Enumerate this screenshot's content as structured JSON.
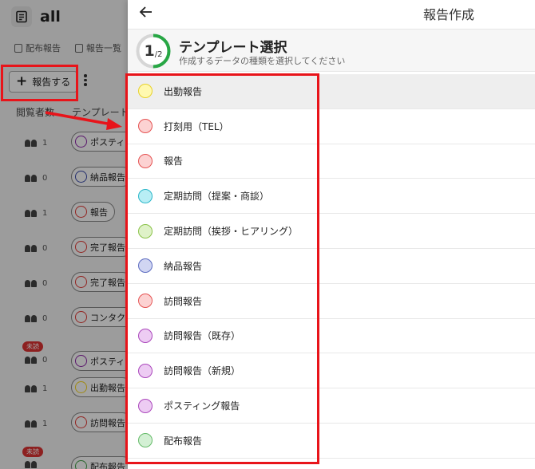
{
  "background": {
    "app_title": "all",
    "tabs": [
      {
        "label": "配布報告"
      },
      {
        "label": "報告一覧"
      }
    ],
    "add_button_label": "報告する",
    "columns": [
      "閲覧者数",
      "テンプレート"
    ],
    "rows": [
      {
        "viewers": "1",
        "unread": "",
        "template": "ポスティング報告",
        "color": "#8e24aa"
      },
      {
        "viewers": "0",
        "unread": "",
        "template": "納品報告",
        "color": "#3949ab"
      },
      {
        "viewers": "1",
        "unread": "",
        "template": "報告",
        "color": "#e53935"
      },
      {
        "viewers": "0",
        "unread": "",
        "template": "完了報告",
        "color": "#e53935"
      },
      {
        "viewers": "0",
        "unread": "",
        "template": "完了報告",
        "color": "#e53935"
      },
      {
        "viewers": "0",
        "unread": "",
        "template": "コンタクト",
        "color": "#e53935"
      },
      {
        "viewers": "0",
        "unread": "未読",
        "template": "ポスティング",
        "color": "#8e24aa"
      },
      {
        "viewers": "1",
        "unread": "",
        "template": "出勤報告",
        "color": "#f9d71c"
      },
      {
        "viewers": "1",
        "unread": "",
        "template": "訪問報告",
        "color": "#e53935"
      },
      {
        "viewers": "",
        "unread": "未読",
        "template": "配布報告",
        "color": "#43a047"
      }
    ]
  },
  "panel": {
    "title": "報告作成",
    "step": {
      "current": "1",
      "total": "/2",
      "progress_fraction": 0.5
    },
    "step_title": "テンプレート選択",
    "step_subtitle": "作成するデータの種類を選択してください",
    "templates": [
      {
        "label": "出勤報告",
        "border": "#e8d22c",
        "fill": "#fff9b0"
      },
      {
        "label": "打刻用（TEL）",
        "border": "#e55353",
        "fill": "#fcd2d2"
      },
      {
        "label": "報告",
        "border": "#e55353",
        "fill": "#fcd2d2"
      },
      {
        "label": "定期訪問（提案・商談）",
        "border": "#2bb7c9",
        "fill": "#b8eef5"
      },
      {
        "label": "定期訪問（挨拶・ヒアリング）",
        "border": "#8bc34a",
        "fill": "#dff2c8"
      },
      {
        "label": "納品報告",
        "border": "#5c6bc0",
        "fill": "#d0d5f2"
      },
      {
        "label": "訪問報告",
        "border": "#e55353",
        "fill": "#fcd2d2"
      },
      {
        "label": "訪問報告（既存）",
        "border": "#ab47bc",
        "fill": "#edccf3"
      },
      {
        "label": "訪問報告（新規）",
        "border": "#ab47bc",
        "fill": "#edccf3"
      },
      {
        "label": "ポスティング報告",
        "border": "#ab47bc",
        "fill": "#edccf3"
      },
      {
        "label": "配布報告",
        "border": "#66bb6a",
        "fill": "#d3f0d4"
      }
    ]
  },
  "colors": {
    "annotation": "#e8141a",
    "progress": "#28a745"
  }
}
